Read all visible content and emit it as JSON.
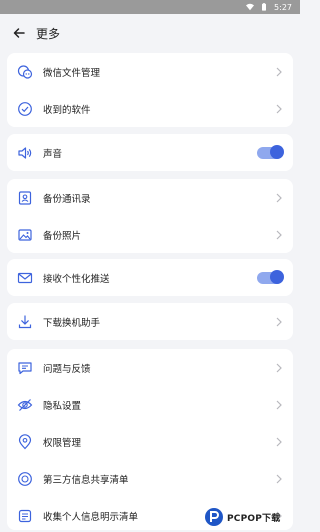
{
  "status_bar": {
    "time": "5:27"
  },
  "header": {
    "title": "更多"
  },
  "groups": [
    {
      "items": [
        {
          "label": "微信文件管理",
          "icon": "wechat-files-icon",
          "control": "chevron"
        },
        {
          "label": "收到的软件",
          "icon": "check-circle-icon",
          "control": "chevron"
        }
      ]
    },
    {
      "items": [
        {
          "label": "声音",
          "icon": "speaker-icon",
          "control": "toggle",
          "toggle_on": true
        }
      ]
    },
    {
      "items": [
        {
          "label": "备份通讯录",
          "icon": "contact-card-icon",
          "control": "chevron"
        },
        {
          "label": "备份照片",
          "icon": "photo-icon",
          "control": "chevron"
        }
      ]
    },
    {
      "items": [
        {
          "label": "接收个性化推送",
          "icon": "envelope-icon",
          "control": "toggle",
          "toggle_on": true
        }
      ]
    },
    {
      "items": [
        {
          "label": "下载换机助手",
          "icon": "download-icon",
          "control": "chevron"
        }
      ]
    },
    {
      "items": [
        {
          "label": "问题与反馈",
          "icon": "feedback-icon",
          "control": "chevron"
        },
        {
          "label": "隐私设置",
          "icon": "eye-off-icon",
          "control": "chevron"
        },
        {
          "label": "权限管理",
          "icon": "location-shield-icon",
          "control": "chevron"
        },
        {
          "label": "第三方信息共享清单",
          "icon": "share-list-icon",
          "control": "chevron"
        },
        {
          "label": "收集个人信息明示清单",
          "icon": "collect-list-icon",
          "control": "chevron"
        }
      ]
    }
  ],
  "watermark": {
    "text": "PCPOP下载"
  },
  "colors": {
    "accent": "#3d63dd",
    "toggle_track": "#8fa8ee",
    "background": "#f3f4f7"
  }
}
